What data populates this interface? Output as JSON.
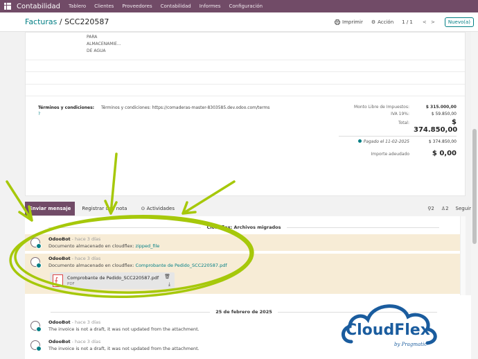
{
  "topnav": {
    "app_name": "Contabilidad",
    "menu": [
      "Tablero",
      "Clientes",
      "Proveedores",
      "Contabilidad",
      "Informes",
      "Configuración"
    ]
  },
  "controlbar": {
    "breadcrumb_parent": "Facturas",
    "breadcrumb_sep": " / ",
    "breadcrumb_current": "SCC220587",
    "print_label": "Imprimir",
    "action_label": "Acción",
    "pager": "1 / 1",
    "new_label": "Nuevo(a)"
  },
  "invoice": {
    "product_lines": [
      "PARA",
      "ALMACENAMIE...",
      "DE AGUA"
    ],
    "terms_label": "Términos y condiciones:",
    "terms_text": "Términos y condiciones: https://comaderas-master-8303585.dev.odoo.com/terms",
    "totals": {
      "untaxed_label": "Monto Libre de Impuestos:",
      "untaxed_value": "$ 315.000,00",
      "tax_label": "IVA 19%:",
      "tax_value": "$ 59.850,00",
      "total_label": "Total:",
      "total_value": "$ 374.850,00",
      "paid_label": "Pagado el 11-02-2025",
      "paid_value": "$ 374.850,00",
      "due_label": "Importe adeudado",
      "due_value": "$ 0,00"
    }
  },
  "chatter": {
    "send_message": "Enviar mensaje",
    "log_note": "Registrar una nota",
    "activities": "Actividades",
    "attachments_count": "2",
    "followers_count": "2",
    "follow": "Seguir",
    "section_title": "Cloudflex: Archivos migrados",
    "messages": [
      {
        "author": "OdooBot",
        "time": "- hace 3 días",
        "prefix": "Documento almacenado en cloudflex: ",
        "link": "zipped_file"
      },
      {
        "author": "OdooBot",
        "time": "- hace 3 días",
        "prefix": "Documento almacenado en cloudflex: ",
        "link": "Comprobante de Pedido_SCC220587.pdf"
      }
    ],
    "attachment": {
      "name": "Comprobante de Pedido_SCC220587.pdf",
      "type": "PDF"
    },
    "date_separator": "25 de febrero de 2025",
    "later_messages": [
      {
        "author": "OdooBot",
        "time": "- hace 3 días",
        "body": "The invoice is not a draft, it was not updated from the attachment."
      },
      {
        "author": "OdooBot",
        "time": "- hace 3 días",
        "body": "The invoice is not a draft, it was not updated from the attachment."
      }
    ]
  },
  "logo": {
    "brand": "CloudFlex",
    "tagline": "by Pragmatic"
  },
  "colors": {
    "brand": "#714b67",
    "accent": "#017e84",
    "highlight": "#a6c80a",
    "logo_blue": "#1a5c9e"
  },
  "icons": [
    "apps-grid-icon",
    "printer-icon",
    "gear-icon",
    "chevron-left-icon",
    "chevron-right-icon",
    "clock-icon",
    "paperclip-icon",
    "user-icon",
    "pdf-icon",
    "trash-icon",
    "download-icon"
  ]
}
